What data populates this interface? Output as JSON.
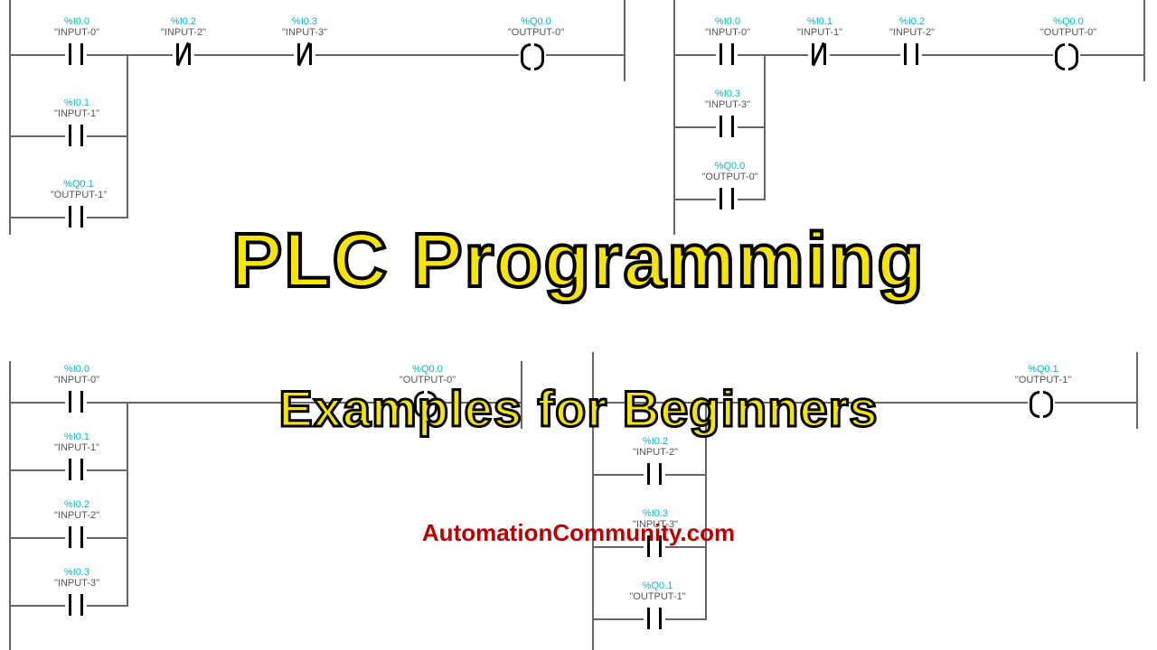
{
  "title_main": "PLC Programming",
  "title_sub": "Examples for Beginners",
  "site": "AutomationCommunity.com",
  "diagrams": {
    "top_left": {
      "rung1": [
        {
          "addr": "%I0.0",
          "name": "\"INPUT-0\"",
          "type": "no"
        },
        {
          "addr": "%I0.2",
          "name": "\"INPUT-2\"",
          "type": "nc"
        },
        {
          "addr": "%I0.3",
          "name": "\"INPUT-3\"",
          "type": "nc"
        },
        {
          "addr": "%Q0.0",
          "name": "\"OUTPUT-0\"",
          "type": "coil"
        }
      ],
      "branches": [
        {
          "addr": "%I0.1",
          "name": "\"INPUT-1\"",
          "type": "no"
        },
        {
          "addr": "%Q0.1",
          "name": "\"OUTPUT-1\"",
          "type": "no"
        }
      ]
    },
    "top_right": {
      "rung1": [
        {
          "addr": "%I0.0",
          "name": "\"INPUT-0\"",
          "type": "no"
        },
        {
          "addr": "%I0.1",
          "name": "\"INPUT-1\"",
          "type": "nc"
        },
        {
          "addr": "%I0.2",
          "name": "\"INPUT-2\"",
          "type": "no"
        },
        {
          "addr": "%Q0.0",
          "name": "\"OUTPUT-0\"",
          "type": "coil"
        }
      ],
      "branches": [
        {
          "addr": "%I0.3",
          "name": "\"INPUT-3\"",
          "type": "no"
        },
        {
          "addr": "%Q0.0",
          "name": "\"OUTPUT-0\"",
          "type": "no"
        }
      ]
    },
    "bottom_left": {
      "rung1": [
        {
          "addr": "%I0.0",
          "name": "\"INPUT-0\"",
          "type": "no"
        },
        {
          "addr": "%Q0.0",
          "name": "\"OUTPUT-0\"",
          "type": "coil"
        }
      ],
      "branches": [
        {
          "addr": "%I0.1",
          "name": "\"INPUT-1\"",
          "type": "no"
        },
        {
          "addr": "%I0.2",
          "name": "\"INPUT-2\"",
          "type": "no"
        },
        {
          "addr": "%I0.3",
          "name": "\"INPUT-3\"",
          "type": "no"
        }
      ]
    },
    "bottom_right": {
      "rung1": [
        {
          "addr": "%Q0.1",
          "name": "\"OUTPUT-1\"",
          "type": "coil"
        }
      ],
      "branches": [
        {
          "addr": "%I0.2",
          "name": "\"INPUT-2\"",
          "type": "no"
        },
        {
          "addr": "%I0.3",
          "name": "\"INPUT-3\"",
          "type": "no"
        },
        {
          "addr": "%Q0.1",
          "name": "\"OUTPUT-1\"",
          "type": "no"
        }
      ]
    }
  }
}
